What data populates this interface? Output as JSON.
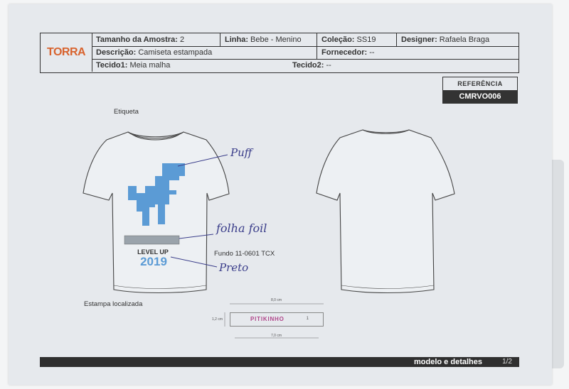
{
  "header": {
    "logo": "TORRA",
    "sample_size_label": "Tamanho da Amostra:",
    "sample_size_value": " 2",
    "line_label": "Linha:",
    "line_value": " Bebe - Menino",
    "collection_label": "Coleção:",
    "collection_value": " SS19",
    "designer_label": "Designer:",
    "designer_value": " Rafaela Braga",
    "description_label": "Descrição:",
    "description_value": " Camiseta estampada",
    "supplier_label": "Fornecedor:",
    "supplier_value": " --",
    "fabric1_label": "Tecido1:",
    "fabric1_value": " Meia malha",
    "fabric2_label": "Tecido2:",
    "fabric2_value": " --"
  },
  "reference": {
    "label": "REFERÊNCIA",
    "code": "CMRVO006"
  },
  "annotations": {
    "etiqueta": "Etiqueta",
    "fundo": "Fundo 11-0601 TCX",
    "estampa": "Estampa localizada",
    "puff": "Puff",
    "folha": "folha foil",
    "preto": "Preto"
  },
  "print": {
    "line1": "LEVEL UP",
    "line2": "2019"
  },
  "label": {
    "text": "PITIKINHO",
    "num": "1",
    "width_top": "8,0 cm",
    "height": "1,2 cm",
    "width_bottom": "7,0 cm"
  },
  "footer": {
    "title": "modelo e detalhes",
    "page": "1/2"
  },
  "colors": {
    "dino": "#5b9bd5",
    "logo": "#d8632e",
    "footer": "#2f2f2f",
    "ink": "#3a3d8a"
  }
}
